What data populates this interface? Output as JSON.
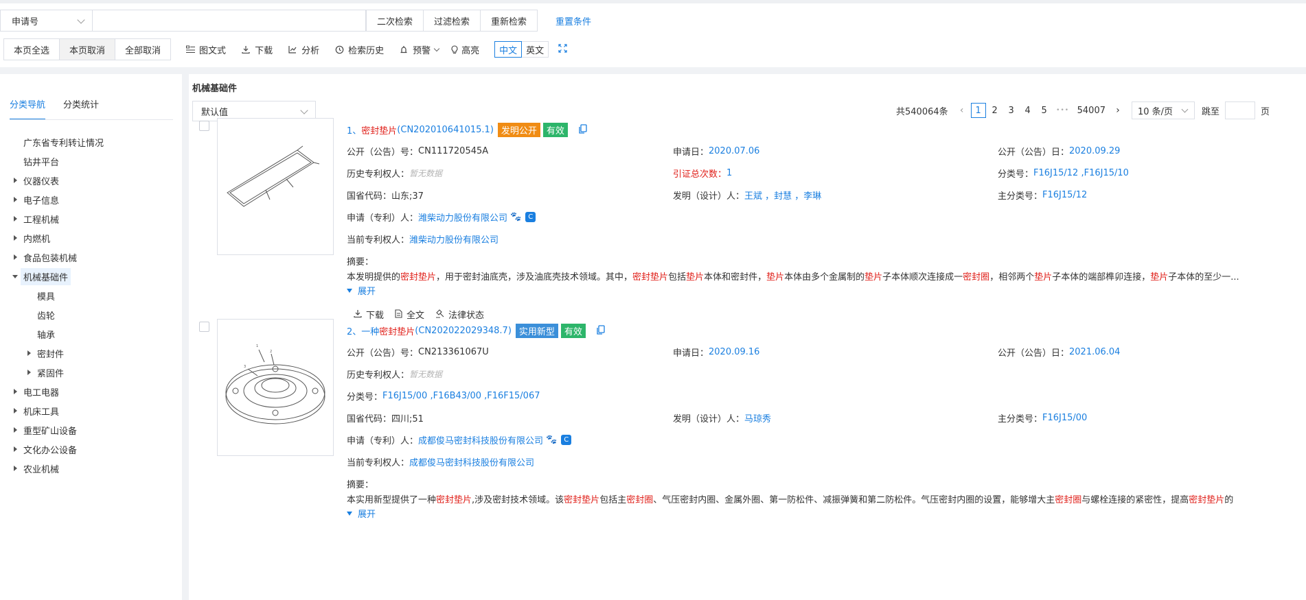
{
  "search": {
    "field": "申请号",
    "placeholder": "",
    "value": "",
    "buttons": [
      "二次检索",
      "过滤检索",
      "重新检索"
    ],
    "reset": "重置条件"
  },
  "toolbar": {
    "select_page": "本页全选",
    "cancel_page": "本页取消",
    "cancel_all": "全部取消",
    "tools": [
      {
        "label": "图文式",
        "icon": "list-image-icon"
      },
      {
        "label": "下载",
        "icon": "download-icon"
      },
      {
        "label": "分析",
        "icon": "chart-line-icon"
      },
      {
        "label": "检索历史",
        "icon": "history-icon"
      },
      {
        "label": "预警",
        "icon": "alarm-icon"
      },
      {
        "label": "高亮",
        "icon": "bulb-icon"
      }
    ],
    "lang_zh": "中文",
    "lang_en": "英文"
  },
  "sidebar": {
    "tabs": [
      "分类导航",
      "分类统计"
    ],
    "tree": [
      {
        "label": "广东省专利转让情况",
        "level": 0,
        "arrow": "none"
      },
      {
        "label": "钻井平台",
        "level": 0,
        "arrow": "none"
      },
      {
        "label": "仪器仪表",
        "level": 0,
        "arrow": "right"
      },
      {
        "label": "电子信息",
        "level": 0,
        "arrow": "right"
      },
      {
        "label": "工程机械",
        "level": 0,
        "arrow": "right"
      },
      {
        "label": "内燃机",
        "level": 0,
        "arrow": "right"
      },
      {
        "label": "食品包装机械",
        "level": 0,
        "arrow": "right"
      },
      {
        "label": "机械基础件",
        "level": 0,
        "arrow": "down",
        "selected": true
      },
      {
        "label": "模具",
        "level": 1,
        "arrow": "none"
      },
      {
        "label": "齿轮",
        "level": 1,
        "arrow": "none"
      },
      {
        "label": "轴承",
        "level": 1,
        "arrow": "none"
      },
      {
        "label": "密封件",
        "level": 1,
        "arrow": "right"
      },
      {
        "label": "紧固件",
        "level": 1,
        "arrow": "right"
      },
      {
        "label": "电工电器",
        "level": 0,
        "arrow": "right"
      },
      {
        "label": "机床工具",
        "level": 0,
        "arrow": "right"
      },
      {
        "label": "重型矿山设备",
        "level": 0,
        "arrow": "right"
      },
      {
        "label": "文化办公设备",
        "level": 0,
        "arrow": "right"
      },
      {
        "label": "农业机械",
        "level": 0,
        "arrow": "right"
      }
    ]
  },
  "main": {
    "title": "机械基础件",
    "sort": "默认值",
    "pager": {
      "total": "共540064条",
      "pages": [
        "1",
        "2",
        "3",
        "4",
        "5"
      ],
      "ellipsis": "•••",
      "last": "54007",
      "page_size": "10 条/页",
      "jump_label": "跳至",
      "page_label": "页"
    },
    "results": [
      {
        "title_prefix": "1、",
        "title_hl": "密封垫片",
        "title_suffix": " (CN202010641015.1)",
        "tags": [
          {
            "text": "发明公开",
            "color": "orange"
          },
          {
            "text": "有效",
            "color": "green"
          }
        ],
        "pub_no_label": "公开（公告）号：",
        "pub_no": "CN111720545A",
        "app_date_label": "申请日：",
        "app_date": "2020.07.06",
        "pub_date_label": "公开（公告）日：",
        "pub_date": "2020.09.29",
        "hist_label": "历史专利权人：",
        "hist": "暂无数据",
        "cite_label": "引证总次数：",
        "cite": "1",
        "cls_label": "分类号：",
        "cls": "F16J15/12 ,F16J15/10",
        "prov_label": "国省代码：",
        "prov": "山东;37",
        "inventor_label": "发明（设计）人：",
        "inventor": "王斌 ，封慧 ，李琳",
        "main_cls_label": "主分类号：",
        "main_cls": "F16J15/12",
        "applicant_label": "申请（专利）人：",
        "applicant": "潍柴动力股份有限公司",
        "owner_label": "当前专利权人：",
        "owner": "潍柴动力股份有限公司",
        "abstract_label": "摘要：",
        "expand": "展开",
        "actions": [
          "下载",
          "全文",
          "法律状态"
        ]
      },
      {
        "title_prefix": "2、一种",
        "title_hl": "密封垫片",
        "title_suffix": " (CN202022029348.7)",
        "tags": [
          {
            "text": "实用新型",
            "color": "blue"
          },
          {
            "text": "有效",
            "color": "green"
          }
        ],
        "pub_no_label": "公开（公告）号：",
        "pub_no": "CN213361067U",
        "app_date_label": "申请日：",
        "app_date": "2020.09.16",
        "pub_date_label": "公开（公告）日：",
        "pub_date": "2021.06.04",
        "hist_label": "历史专利权人：",
        "hist": "暂无数据",
        "cls_label": "分类号：",
        "cls": "F16J15/00 ,F16B43/00 ,F16F15/067",
        "prov_label": "国省代码：",
        "prov": "四川;51",
        "inventor_label": "发明（设计）人：",
        "inventor": "马琼秀",
        "main_cls_label": "主分类号：",
        "main_cls": "F16J15/00",
        "applicant_label": "申请（专利）人：",
        "applicant": "成都俊马密封科技股份有限公司",
        "owner_label": "当前专利权人：",
        "owner": "成都俊马密封科技股份有限公司",
        "abstract_label": "摘要：",
        "expand": "展开"
      }
    ]
  },
  "colors": {
    "accent": "#1a7fe0",
    "highlight": "#e0201a",
    "tag_orange": "#f08c14",
    "tag_green": "#2db56a",
    "tag_blue": "#3b8fd9"
  }
}
